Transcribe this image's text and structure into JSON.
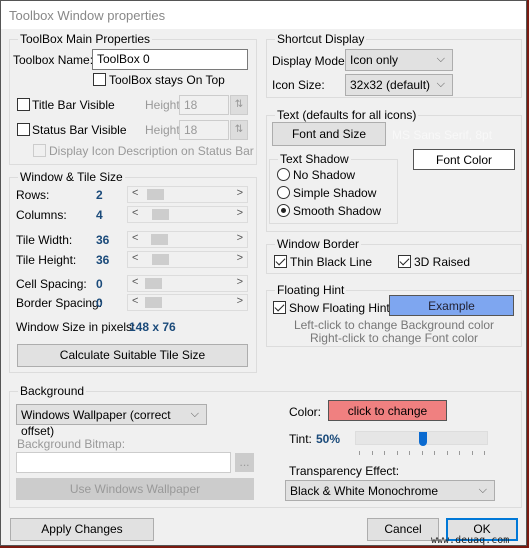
{
  "window": {
    "title": "Toolbox Window properties"
  },
  "main": {
    "group": "ToolBox Main Properties",
    "name_label": "Toolbox Name:",
    "name_value": "ToolBox 0",
    "stays_on_top": "ToolBox stays On Top",
    "stays_on_top_checked": false,
    "title_bar": "Title Bar Visible",
    "title_bar_checked": false,
    "height_label": "Height:",
    "title_height": "18",
    "status_bar": "Status Bar Visible",
    "status_bar_checked": false,
    "status_height": "18",
    "display_desc": "Display Icon Description on Status Bar",
    "display_desc_checked": false
  },
  "tile": {
    "group": "Window & Tile Size",
    "rows": [
      {
        "label": "Rows:",
        "value": "2"
      },
      {
        "label": "Columns:",
        "value": "4"
      },
      {
        "label": "Tile Width:",
        "value": "36"
      },
      {
        "label": "Tile Height:",
        "value": "36"
      },
      {
        "label": "Cell Spacing:",
        "value": "0"
      },
      {
        "label": "Border Spacing:",
        "value": "0"
      }
    ],
    "size_label": "Window Size in pixels:",
    "size_value": "148 x 76",
    "calc_button": "Calculate Suitable Tile Size"
  },
  "shortcut": {
    "group": "Shortcut Display",
    "mode_label": "Display Mode:",
    "mode_value": "Icon only",
    "size_label": "Icon Size:",
    "size_value": "32x32 (default)"
  },
  "text": {
    "group": "Text (defaults for all icons)",
    "font_button": "Font and Size",
    "font_desc": "MS Sans Serif, 8pt",
    "font_color_button": "Font Color",
    "shadow_group": "Text Shadow",
    "shadows": [
      "No Shadow",
      "Simple Shadow",
      "Smooth Shadow"
    ],
    "shadow_selected": "Smooth Shadow"
  },
  "border": {
    "group": "Window Border",
    "thin": "Thin Black Line",
    "thin_checked": true,
    "raised": "3D Raised",
    "raised_checked": true
  },
  "hint": {
    "group": "Floating Hint",
    "show": "Show Floating Hint",
    "show_checked": true,
    "example": "Example",
    "example_color": "#7ea6f0",
    "line1": "Left-click to change Background color",
    "line2": "Right-click to change Font color"
  },
  "background": {
    "group": "Background",
    "mode_value": "Windows Wallpaper (correct offset)",
    "bitmap_label": "Background Bitmap:",
    "bitmap_value": "",
    "browse": "...",
    "use_wallpaper": "Use Windows Wallpaper",
    "color_label": "Color:",
    "color_button": "click to change",
    "color": "#f08080",
    "tint_label": "Tint:",
    "tint_value": "50%",
    "tint_percent": 50,
    "effect_label": "Transparency Effect:",
    "effect_value": "Black & White Monochrome"
  },
  "footer": {
    "apply": "Apply Changes",
    "cancel": "Cancel",
    "ok": "OK",
    "watermark": "www.deuaq.com"
  }
}
